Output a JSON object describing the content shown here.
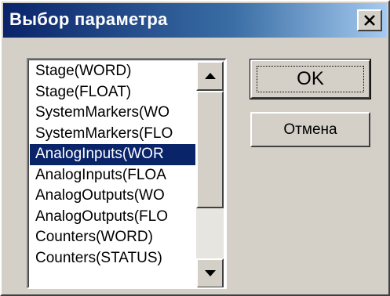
{
  "window": {
    "title": "Выбор параметра"
  },
  "list": {
    "items": [
      "Stage(WORD)",
      "Stage(FLOAT)",
      "SystemMarkers(WO",
      "SystemMarkers(FLO",
      "AnalogInputs(WOR",
      "AnalogInputs(FLOA",
      "AnalogOutputs(WO",
      "AnalogOutputs(FLO",
      "Counters(WORD)",
      "Counters(STATUS)"
    ],
    "selected": "AnalogInputs(WOR"
  },
  "buttons": {
    "ok": "OK",
    "cancel": "Отмена"
  },
  "icons": {
    "close": "close-icon",
    "scroll_up": "triangle-up-icon",
    "scroll_down": "triangle-down-icon"
  },
  "colors": {
    "title_start": "#0a246a",
    "title_end": "#a6caf0",
    "selection": "#0a246a",
    "face": "#d4d0c8"
  }
}
